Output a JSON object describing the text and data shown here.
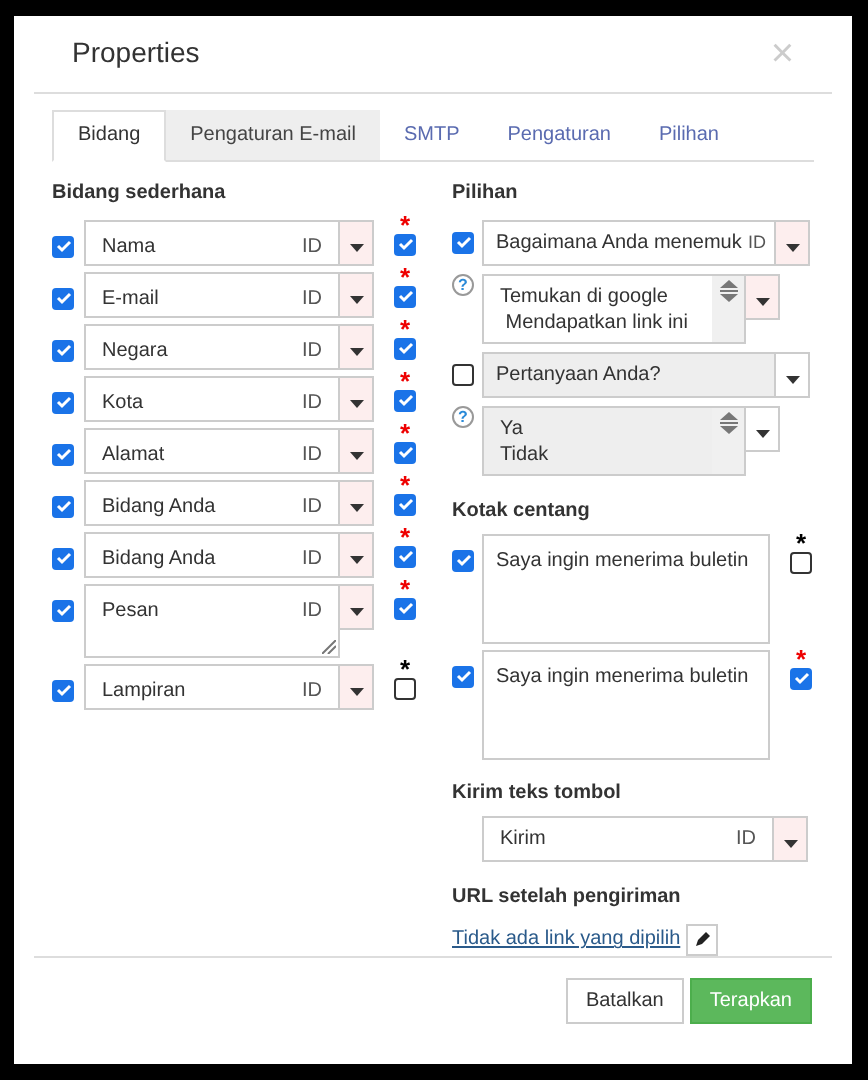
{
  "dialog": {
    "title": "Properties",
    "close": "×"
  },
  "tabs": [
    {
      "label": "Bidang",
      "selected": true
    },
    {
      "label": "Pengaturan E-mail",
      "selected": false
    },
    {
      "label": "SMTP",
      "selected": false
    },
    {
      "label": "Pengaturan",
      "selected": false
    },
    {
      "label": "Pilihan",
      "selected": false
    }
  ],
  "simple_fields": {
    "heading": "Bidang sederhana",
    "items": [
      {
        "label": "Nama",
        "id_label": "ID",
        "required_mark": "*",
        "kind": "input",
        "enabled": true,
        "required": true
      },
      {
        "label": "E-mail",
        "id_label": "ID",
        "required_mark": "*",
        "kind": "input",
        "enabled": true,
        "required": true
      },
      {
        "label": "Negara",
        "id_label": "ID",
        "required_mark": "*",
        "kind": "input",
        "enabled": true,
        "required": true
      },
      {
        "label": "Kota",
        "id_label": "ID",
        "required_mark": "*",
        "kind": "input",
        "enabled": true,
        "required": true
      },
      {
        "label": "Alamat",
        "id_label": "ID",
        "required_mark": "*",
        "kind": "input",
        "enabled": true,
        "required": true
      },
      {
        "label": "Bidang Anda",
        "id_label": "ID",
        "required_mark": "*",
        "kind": "input",
        "enabled": true,
        "required": true
      },
      {
        "label": "Bidang Anda",
        "id_label": "ID",
        "required_mark": "*",
        "kind": "input",
        "enabled": true,
        "required": true
      },
      {
        "label": "Pesan",
        "id_label": "ID",
        "required_mark": "*",
        "kind": "textarea",
        "enabled": true,
        "required": true
      },
      {
        "label": "Lampiran",
        "id_label": "ID",
        "required_mark": "*",
        "kind": "input",
        "enabled": true,
        "required": false
      }
    ]
  },
  "choices": {
    "heading": "Pilihan",
    "items": [
      {
        "question": "Bagaimana Anda menemuk",
        "id_label": "ID",
        "help": "?",
        "enabled": true,
        "options": "Temukan di google\n Mendapatkan link ini"
      },
      {
        "question": "Pertanyaan Anda?",
        "help": "?",
        "enabled": false,
        "options": "Ya\nTidak"
      }
    ]
  },
  "checkboxes": {
    "heading": "Kotak centang",
    "items": [
      {
        "text": "Saya ingin menerima buletin",
        "required_mark": "*",
        "enabled": true,
        "required": false
      },
      {
        "text": "Saya ingin menerima buletin",
        "required_mark": "*",
        "enabled": true,
        "required": true
      }
    ]
  },
  "submit": {
    "heading": "Kirim teks tombol",
    "value": "Kirim",
    "id_label": "ID"
  },
  "redirect": {
    "heading": "URL setelah pengiriman",
    "link": "Tidak ada link yang dipilih"
  },
  "buttons": {
    "cancel": "Batalkan",
    "apply": "Terapkan"
  }
}
